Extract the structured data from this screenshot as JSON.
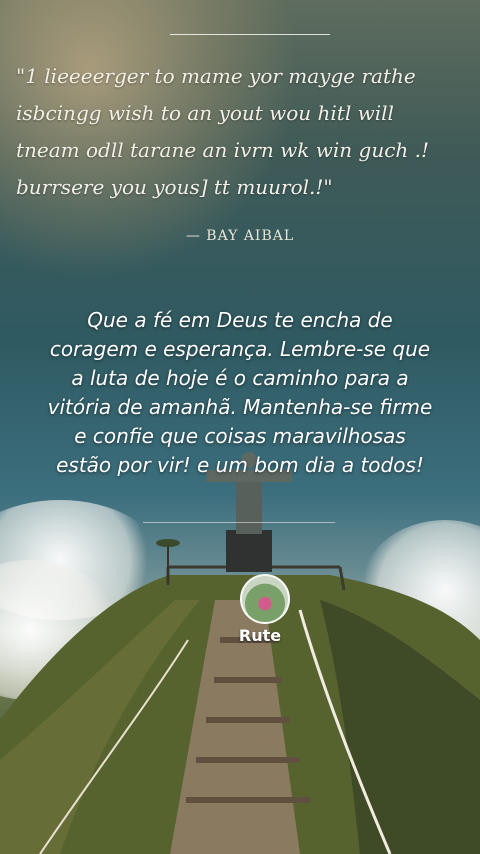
{
  "quote": {
    "lines": [
      "\"1 lieeeerger to mame yor mayge rathe",
      "isbcingg wish to an yout wou hitl will",
      "tneam odll tarane an ivrn wk win guch .!",
      "burrsere you yous] tt muurol.!\""
    ],
    "author": "— BAY AIBAL"
  },
  "message": "Que a fé em Deus te encha de coragem e esperança. Lembre-se que a luta de hoje é o caminho para a vitória de amanhã. Mantenha-se firme e confie que coisas maravilhosas estão por vir! e um bom dia a todos!",
  "profile": {
    "name": "Rute"
  }
}
